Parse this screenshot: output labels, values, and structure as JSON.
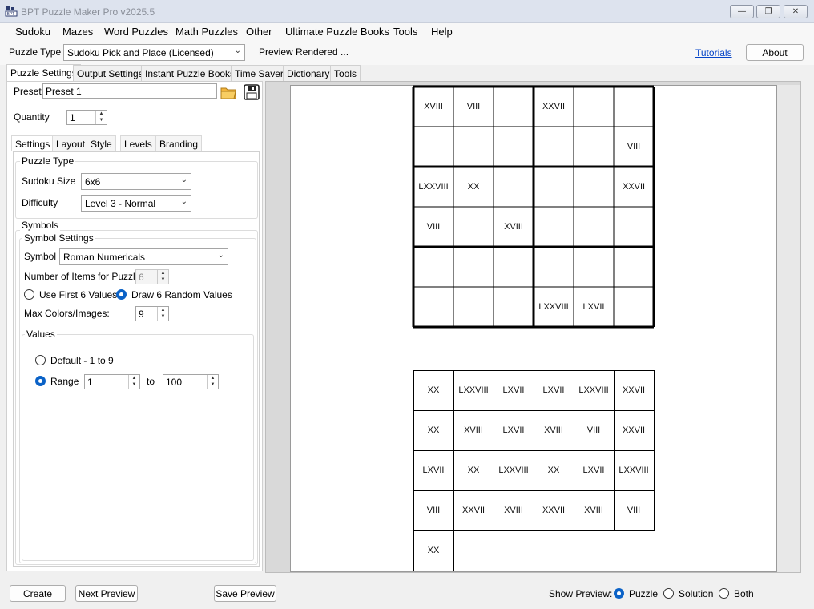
{
  "window": {
    "title": "BPT Puzzle Maker Pro v2025.5"
  },
  "menu": [
    "Sudoku",
    "Mazes",
    "Word Puzzles",
    "Math Puzzles",
    "Other",
    "Ultimate Puzzle Books",
    "Tools",
    "Help"
  ],
  "toolbar": {
    "puzzle_type_label": "Puzzle Type",
    "puzzle_type_value": "Sudoku Pick and Place (Licensed)",
    "status": "Preview Rendered ...",
    "tutorials_link": "Tutorials",
    "about_button": "About"
  },
  "main_tabs": [
    "Puzzle Settings",
    "Output Settings",
    "Instant Puzzle Books",
    "Time Saver",
    "Dictionary",
    "Tools"
  ],
  "preset": {
    "label": "Preset",
    "value": "Preset 1"
  },
  "quantity": {
    "label": "Quantity",
    "value": "1"
  },
  "sub_tabs": [
    "Settings",
    "Layout",
    "Style",
    "Levels",
    "Branding"
  ],
  "puzzle_type_group": {
    "title": "Puzzle Type",
    "size_label": "Sudoku Size",
    "size_value": "6x6",
    "difficulty_label": "Difficulty",
    "difficulty_value": "Level 3 - Normal"
  },
  "symbols": {
    "title": "Symbols",
    "settings_title": "Symbol Settings",
    "symbol_label": "Symbol",
    "symbol_value": "Roman Numericals",
    "items_label": "Number of Items for Puzzle:",
    "items_value": "6",
    "use_first_label": "Use First 6 Values",
    "draw_random_label": "Draw 6 Random Values",
    "draw_random_selected": true,
    "max_colors_label": "Max Colors/Images:",
    "max_colors_value": "9"
  },
  "values": {
    "title": "Values",
    "default_label": "Default - 1 to 9",
    "range_label": "Range",
    "range_selected": true,
    "range_from": "1",
    "to_label": "to",
    "range_to": "100"
  },
  "preview": {
    "grid": [
      [
        "XVIII",
        "VIII",
        "",
        "XXVII",
        "",
        ""
      ],
      [
        "",
        "",
        "",
        "",
        "",
        "VIII"
      ],
      [
        "LXXVIII",
        "XX",
        "",
        "",
        "",
        "XXVII"
      ],
      [
        "VIII",
        "",
        "XVIII",
        "",
        "",
        ""
      ],
      [
        "",
        "",
        "",
        "",
        "",
        ""
      ],
      [
        "",
        "",
        "",
        "LXXVIII",
        "LXVII",
        ""
      ]
    ],
    "pieces": [
      "XX",
      "LXXVIII",
      "LXVII",
      "LXVII",
      "LXXVIII",
      "XXVII",
      "XX",
      "XVIII",
      "LXVII",
      "XVIII",
      "VIII",
      "XXVII",
      "LXVII",
      "XX",
      "LXXVIII",
      "XX",
      "LXVII",
      "LXXVIII",
      "VIII",
      "XXVII",
      "XVIII",
      "XXVII",
      "XVIII",
      "VIII",
      "XX"
    ]
  },
  "bottom": {
    "create_button": "Create",
    "next_preview_button": "Next Preview",
    "save_preview_button": "Save Preview",
    "show_preview_label": "Show Preview:",
    "options": [
      "Puzzle",
      "Solution",
      "Both"
    ],
    "selected": "Puzzle"
  }
}
